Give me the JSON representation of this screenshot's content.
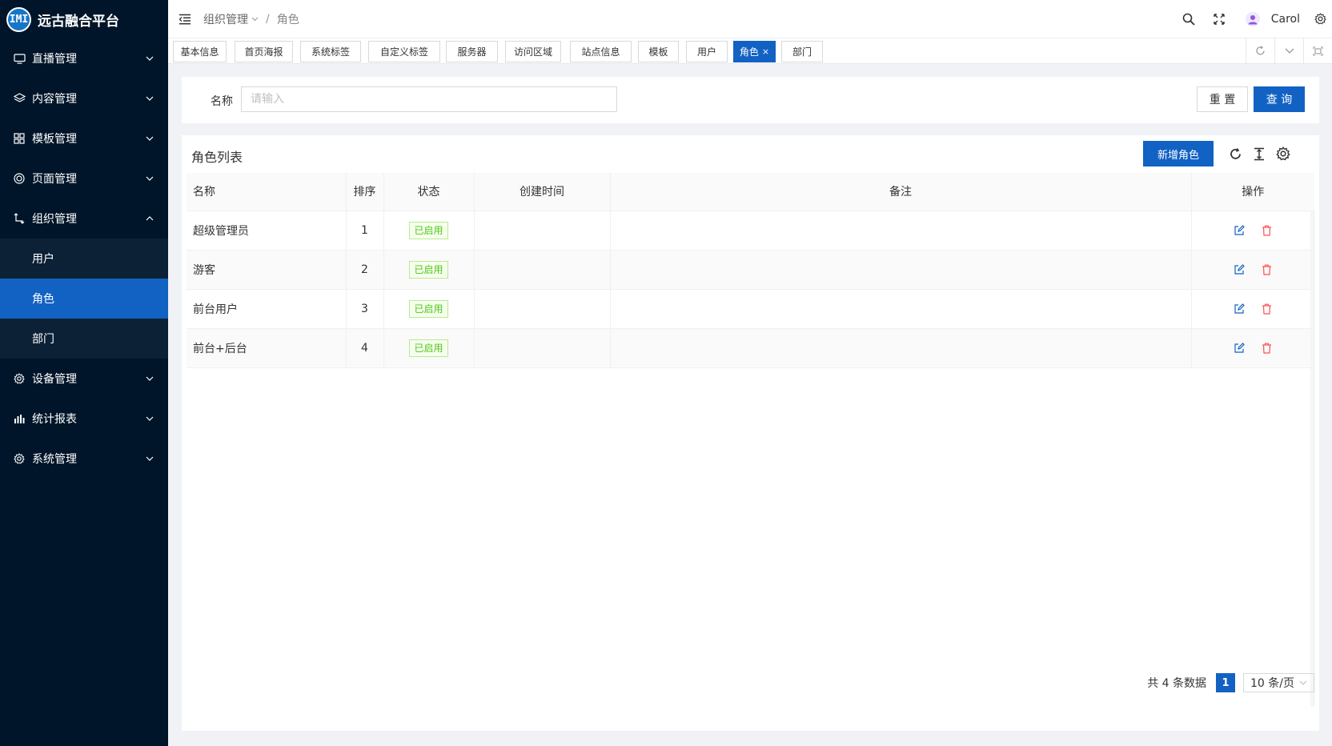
{
  "app": {
    "logo_text": "远古融合平台",
    "logo_mark": "IMI"
  },
  "sidebar": {
    "items": [
      {
        "label": "直播管理",
        "icon": "monitor-icon"
      },
      {
        "label": "内容管理",
        "icon": "layers-icon"
      },
      {
        "label": "模板管理",
        "icon": "grid-icon"
      },
      {
        "label": "页面管理",
        "icon": "page-icon"
      },
      {
        "label": "组织管理",
        "icon": "org-icon",
        "expanded": true
      },
      {
        "label": "设备管理",
        "icon": "gear-icon"
      },
      {
        "label": "统计报表",
        "icon": "bar-chart-icon"
      },
      {
        "label": "系统管理",
        "icon": "gear-icon"
      }
    ],
    "sub_items": [
      {
        "label": "用户"
      },
      {
        "label": "角色",
        "active": true
      },
      {
        "label": "部门"
      }
    ]
  },
  "header": {
    "breadcrumb": [
      "组织管理",
      "角色"
    ],
    "separator": "/",
    "username": "Carol"
  },
  "tabs": [
    {
      "label": "基本信息"
    },
    {
      "label": "首页海报"
    },
    {
      "label": "系统标签"
    },
    {
      "label": "自定义标签"
    },
    {
      "label": "服务器"
    },
    {
      "label": "访问区域"
    },
    {
      "label": "站点信息"
    },
    {
      "label": "模板"
    },
    {
      "label": "用户"
    },
    {
      "label": "角色",
      "active": true,
      "close": "×"
    },
    {
      "label": "部门"
    }
  ],
  "search": {
    "label": "名称",
    "placeholder": "请输入",
    "value": "",
    "reset_label": "重 置",
    "query_label": "查 询"
  },
  "table_panel": {
    "title": "角色列表",
    "add_label": "新增角色",
    "columns": [
      "名称",
      "排序",
      "状态",
      "创建时间",
      "备注",
      "操作"
    ],
    "rows": [
      {
        "name": "超级管理员",
        "sort": "1",
        "status": "已启用",
        "created": "",
        "remark": ""
      },
      {
        "name": "游客",
        "sort": "2",
        "status": "已启用",
        "created": "",
        "remark": ""
      },
      {
        "name": "前台用户",
        "sort": "3",
        "status": "已启用",
        "created": "",
        "remark": ""
      },
      {
        "name": "前台+后台",
        "sort": "4",
        "status": "已启用",
        "created": "",
        "remark": ""
      }
    ]
  },
  "pagination": {
    "total_text": "共 4 条数据",
    "current_page": "1",
    "page_size": "10 条/页"
  },
  "colors": {
    "sidebar_bg": "#001529",
    "primary": "#1262c4",
    "success": "#52c41a",
    "danger": "#ff4d4f"
  }
}
